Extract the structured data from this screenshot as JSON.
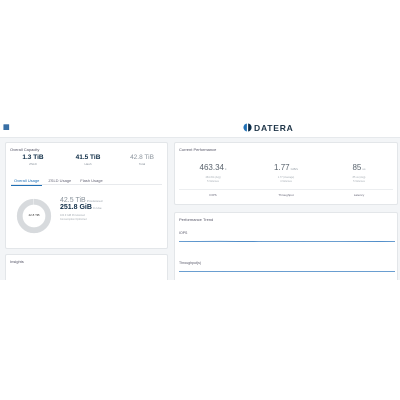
{
  "app": {
    "brand": "DATERA",
    "colors": {
      "accent": "#1f6fb5",
      "navy": "#0d2b45",
      "donut_fill": "#d7dadd",
      "trend": "#3a7fc2"
    }
  },
  "capacity": {
    "title": "Overall Capacity",
    "stats": [
      {
        "value": "1.3 TiB",
        "label": "ZSLD"
      },
      {
        "value": "41.5 TiB",
        "label": "Hash"
      },
      {
        "value": "42.8 TiB",
        "label": "Total"
      }
    ],
    "tabs": [
      "Overall Usage",
      "ZSLD Usage",
      "Flash Usage"
    ],
    "active_tab": 0,
    "donut": {
      "text": "42.8 TiB",
      "used_fraction": 0.99
    },
    "usage": {
      "line1_value": "42.5 TiB",
      "line1_unit": "Provisioned",
      "line2_value": "251.8 GiB",
      "line2_unit": "In Use",
      "note1": "100.9 GiB Provisioned",
      "note2": "Consumption Optimized"
    }
  },
  "insights": {
    "title": "Insights"
  },
  "performance": {
    "title": "Current Performance",
    "metrics": [
      {
        "value": "463.34",
        "unit": "k",
        "sub1": "464.4% (Avg)",
        "sub2": "5 Volumes",
        "label": "IOPS"
      },
      {
        "value": "1.77",
        "unit": "GiB/s",
        "sub1": "1.77 (Average)",
        "sub2": "4 Volumes",
        "label": "Throughput"
      },
      {
        "value": "85",
        "unit": "us",
        "sub1": "85 us (Avg)",
        "sub2": "5 Volumes",
        "label": "Latency"
      }
    ]
  },
  "trend": {
    "title": "Performance Trend",
    "series_labels": [
      "IOPS",
      "Throughput(s)"
    ]
  }
}
